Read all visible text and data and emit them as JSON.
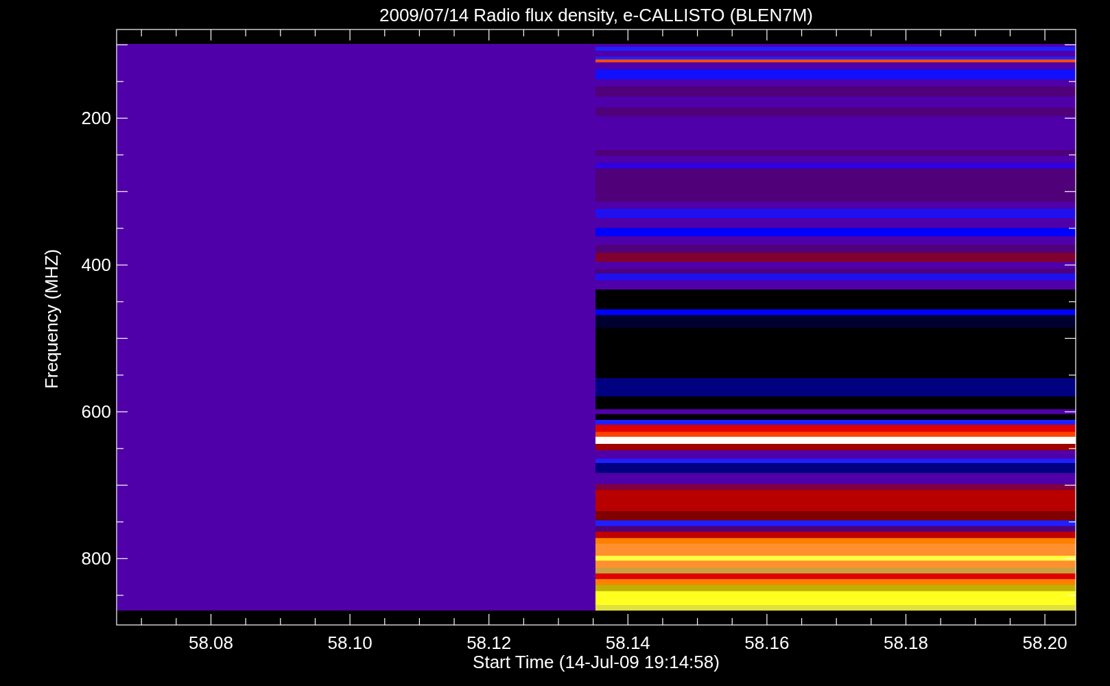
{
  "plot": {
    "title": "2009/07/14  Radio flux density, e-CALLISTO (BLEN7M)",
    "ylabel": "Frequency (MHZ)",
    "xlabel": "Start Time (14-Jul-09 19:14:58)",
    "yticks": [
      "200",
      "400",
      "600",
      "800"
    ],
    "xticks": [
      "58.08",
      "58.10",
      "58.12",
      "58.14",
      "58.16",
      "58.18",
      "58.20"
    ]
  }
}
